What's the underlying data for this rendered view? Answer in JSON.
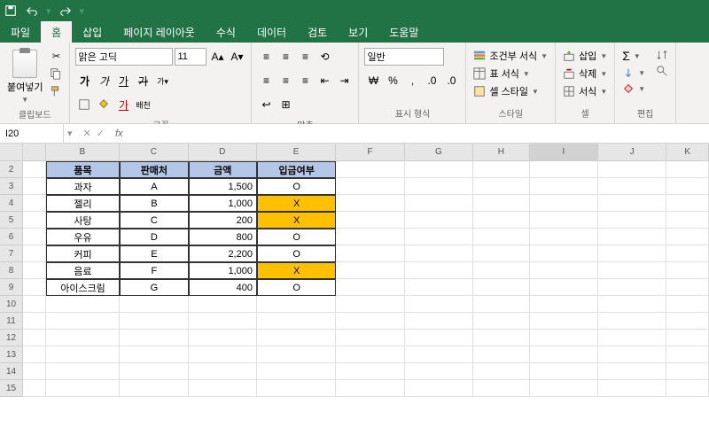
{
  "qat": {
    "save": "save",
    "undo": "undo",
    "redo": "redo"
  },
  "tabs": [
    "파일",
    "홈",
    "삽입",
    "페이지 레이아웃",
    "수식",
    "데이터",
    "검토",
    "보기",
    "도움말"
  ],
  "activeTab": 1,
  "ribbon": {
    "clipboard": {
      "label": "클립보드",
      "paste": "붙여넣기"
    },
    "font": {
      "label": "글꼴",
      "name": "맑은 고딕",
      "size": "11",
      "bold": "가",
      "italic": "가",
      "underline": "가",
      "strike": "가",
      "hanja": "배천"
    },
    "align": {
      "label": "맞춤"
    },
    "number": {
      "label": "표시 형식",
      "format": "일반"
    },
    "styles": {
      "label": "스타일",
      "condFormat": "조건부 서식",
      "tableFormat": "표 서식",
      "cellStyle": "셀 스타일"
    },
    "cells": {
      "label": "셀",
      "insert": "삽입",
      "delete": "삭제",
      "format": "서식"
    },
    "editing": {
      "label": "편집"
    }
  },
  "namebox": "I20",
  "formula": "",
  "columns": [
    "B",
    "C",
    "D",
    "E",
    "F",
    "G",
    "H",
    "I",
    "J",
    "K"
  ],
  "rowStart": 2,
  "rowCount": 14,
  "selectedCell": {
    "col": "I",
    "row": 20
  },
  "table": {
    "headers": [
      "품목",
      "판매처",
      "금액",
      "입금여부"
    ],
    "rows": [
      {
        "item": "과자",
        "seller": "A",
        "amount": "1,500",
        "paid": "O",
        "highlight": false
      },
      {
        "item": "젤리",
        "seller": "B",
        "amount": "1,000",
        "paid": "X",
        "highlight": true
      },
      {
        "item": "사탕",
        "seller": "C",
        "amount": "200",
        "paid": "X",
        "highlight": true
      },
      {
        "item": "우유",
        "seller": "D",
        "amount": "800",
        "paid": "O",
        "highlight": false
      },
      {
        "item": "커피",
        "seller": "E",
        "amount": "2,200",
        "paid": "O",
        "highlight": false
      },
      {
        "item": "음료",
        "seller": "F",
        "amount": "1,000",
        "paid": "X",
        "highlight": true
      },
      {
        "item": "아이스크림",
        "seller": "G",
        "amount": "400",
        "paid": "O",
        "highlight": false
      }
    ]
  }
}
